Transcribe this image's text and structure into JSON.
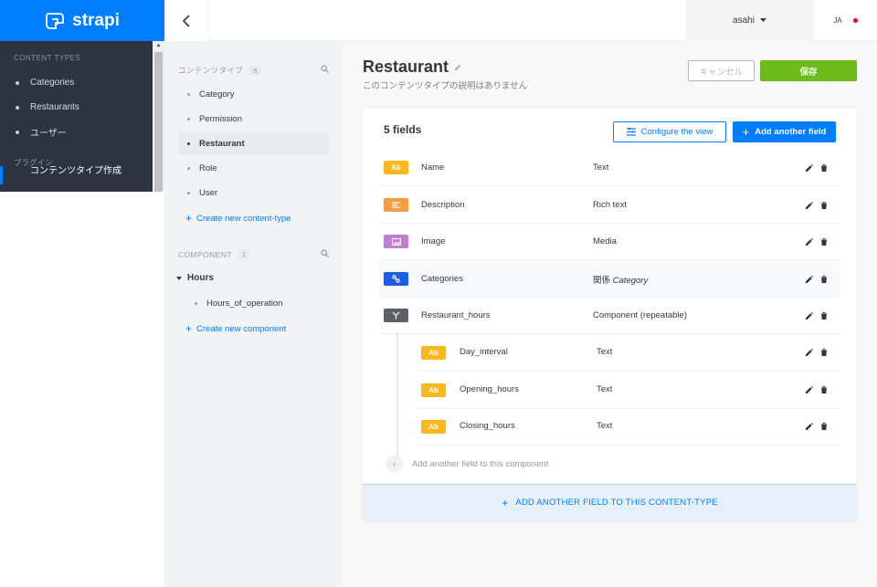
{
  "brand": {
    "name": "strapi"
  },
  "leftnav": {
    "section_title": "CONTENT TYPES",
    "items": [
      {
        "label": "Categories"
      },
      {
        "label": "Restaurants"
      },
      {
        "label": "ユーザー"
      }
    ],
    "plugins_title": "プラグイン",
    "active_plugin": "コンテンツタイプ作成"
  },
  "topbar": {
    "username": "asahi",
    "language": "JA"
  },
  "ctb": {
    "content_types_title": "コンテンツタイプ",
    "content_types_count": "5",
    "content_types": [
      {
        "label": "Category"
      },
      {
        "label": "Permission"
      },
      {
        "label": "Restaurant"
      },
      {
        "label": "Role"
      },
      {
        "label": "User"
      }
    ],
    "create_content_type": "Create new content-type",
    "components_title": "COMPONENT",
    "components_count": "1",
    "group_name": "Hours",
    "components": [
      {
        "label": "Hours_of_operation"
      }
    ],
    "create_component": "Create new component"
  },
  "main": {
    "title": "Restaurant",
    "subtitle": "このコンテンツタイプの説明はありません",
    "cancel": "キャンセル",
    "save": "保存",
    "fields_title": "5 fields",
    "configure_view": "Configure the view",
    "add_field": "Add another field",
    "fields": [
      {
        "icon": "Ab",
        "name": "Name",
        "type": "Text",
        "color": "#fab81b"
      },
      {
        "icon": "",
        "name": "Description",
        "type": "Rich text",
        "color": "#f29d41"
      },
      {
        "icon": "",
        "name": "Image",
        "type": "Media",
        "color": "#c07ed5"
      },
      {
        "icon": "",
        "name": "Categories",
        "type": "関係",
        "type_extra": "Category",
        "color": "#1c5de7"
      },
      {
        "icon": "",
        "name": "Restaurant_hours",
        "type": "Component (repeatable)",
        "color": "#5d6166"
      }
    ],
    "sub_fields": [
      {
        "icon": "Ab",
        "name": "Day_interval",
        "type": "Text"
      },
      {
        "icon": "Ab",
        "name": "Opening_hours",
        "type": "Text"
      },
      {
        "icon": "Ab",
        "name": "Closing_hours",
        "type": "Text"
      }
    ],
    "add_sub_field": "Add another field to this component",
    "add_ct_field": "ADD ANOTHER FIELD TO THIS CONTENT-TYPE"
  },
  "colors": {
    "primary": "#007eff",
    "save": "#6dbb1a",
    "nav_bg": "#2e3340",
    "text_icon": "#fab81b"
  }
}
